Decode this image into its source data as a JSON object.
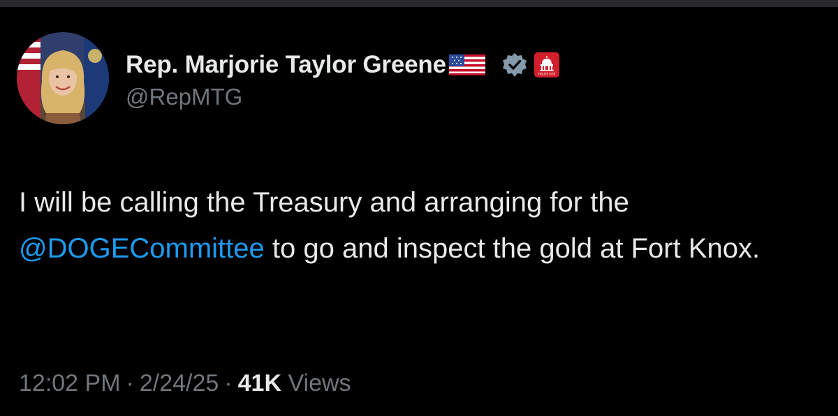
{
  "author": {
    "display_name": "Rep. Marjorie Taylor Greene",
    "handle": "@RepMTG",
    "flag_icon": "us-flag-icon",
    "verified_icon": "verified-badge-icon",
    "affiliation_icon": "house-gop-icon",
    "affiliation_badge_text": "HOUSE GOP"
  },
  "tweet": {
    "text_before": "I will be calling the Treasury and arranging for the ",
    "mention": "@DOGECommittee",
    "text_after": " to go and inspect the gold at Fort Knox."
  },
  "meta": {
    "time": "12:02 PM",
    "separator": "·",
    "date": "2/24/25",
    "views_count": "41K",
    "views_label": "Views"
  },
  "colors": {
    "background": "#000000",
    "text_primary": "#e7e9ea",
    "text_secondary": "#71767b",
    "link": "#1d9bf0",
    "verified": "#829aab",
    "affiliation_bg": "#d21f2b"
  }
}
